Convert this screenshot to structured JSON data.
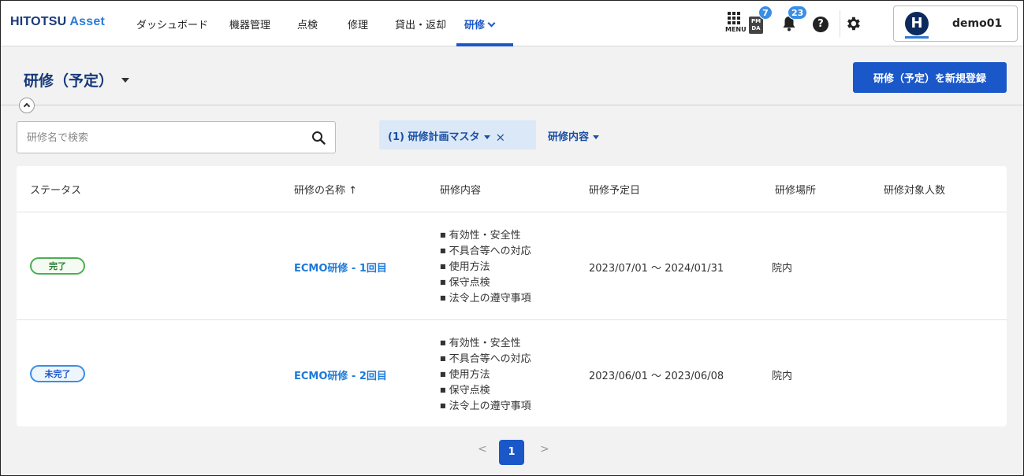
{
  "app": {
    "logo_primary": "HITOTSU",
    "logo_secondary": "Asset",
    "brand_color": "#1a57c9"
  },
  "nav": {
    "items": [
      {
        "label": "ダッシュボード"
      },
      {
        "label": "機器管理"
      },
      {
        "label": "点検"
      },
      {
        "label": "修理"
      },
      {
        "label": "貸出・返却"
      },
      {
        "label": "研修",
        "active": true
      }
    ]
  },
  "header_tools": {
    "menu_label": "MENU",
    "pmda_label": "PM DA",
    "pmda_badge": "7",
    "notification_badge": "23",
    "help_label": "?",
    "user_initial": "H",
    "username": "demo01"
  },
  "page": {
    "title": "研修（予定）",
    "new_button_label": "研修（予定）を新規登録"
  },
  "filters": {
    "search_placeholder": "研修名で検索",
    "chip_label": "(1) 研修計画マスタ",
    "chip_close": "×",
    "dropdown_label": "研修内容"
  },
  "table": {
    "headers": {
      "status": "ステータス",
      "name": "研修の名称 ↑",
      "contents": "研修内容",
      "date": "研修予定日",
      "place": "研修場所",
      "count": "研修対象人数"
    },
    "rows": [
      {
        "status": "完了",
        "name": "ECMO研修 - 1回目",
        "contents": [
          "有効性・安全性",
          "不具合等への対応",
          "使用方法",
          "保守点検",
          "法令上の遵守事項"
        ],
        "date": "2023/07/01 ～ 2024/01/31",
        "place": "院内",
        "count": ""
      },
      {
        "status": "未完了",
        "name": "ECMO研修 - 2回目",
        "contents": [
          "有効性・安全性",
          "不具合等への対応",
          "使用方法",
          "保守点検",
          "法令上の遵守事項"
        ],
        "date": "2023/06/01 ～ 2023/06/08",
        "place": "院内",
        "count": ""
      }
    ]
  },
  "pagination": {
    "prev": "<",
    "current": "1",
    "next": ">"
  }
}
